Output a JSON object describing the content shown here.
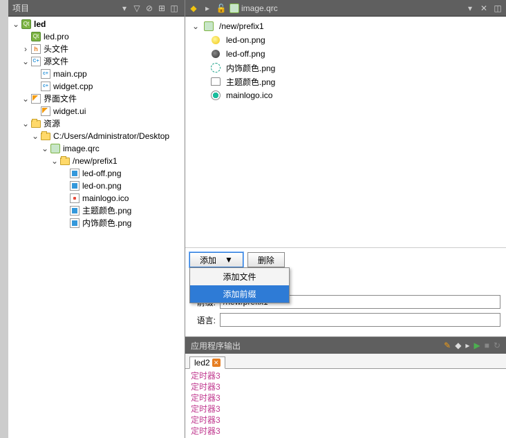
{
  "sidebar": {
    "title": "项目",
    "project": "led",
    "pro_file": "led.pro",
    "headers": "头文件",
    "sources": "源文件",
    "src_main": "main.cpp",
    "src_widget": "widget.cpp",
    "forms": "界面文件",
    "form_widget": "widget.ui",
    "resources": "资源",
    "res_path": "C:/Users/Administrator/Desktop",
    "qrc": "image.qrc",
    "prefix": "/new/prefix1",
    "f_ledoff": "led-off.png",
    "f_ledon": "led-on.png",
    "f_logo": "mainlogo.ico",
    "f_theme": "主题颜色.png",
    "f_inner": "内饰颜色.png"
  },
  "tab": {
    "file": "image.qrc"
  },
  "rv": {
    "prefix": "/new/prefix1",
    "ledon": "led-on.png",
    "ledoff": "led-off.png",
    "inner": "内饰颜色.png",
    "theme": "主题颜色.png",
    "logo": "mainlogo.ico"
  },
  "btns": {
    "add": "添加",
    "del": "删除"
  },
  "menu": {
    "add_file": "添加文件",
    "add_prefix": "添加前缀"
  },
  "props": {
    "prefix_label": "前缀:",
    "prefix_value": "/new/prefix1",
    "lang_label": "语言:",
    "lang_value": ""
  },
  "output": {
    "title": "应用程序输出",
    "tab": "led2",
    "lines": [
      "定时器3",
      "定时器3",
      "定时器3",
      "定时器3",
      "定时器3",
      "定时器3"
    ]
  }
}
